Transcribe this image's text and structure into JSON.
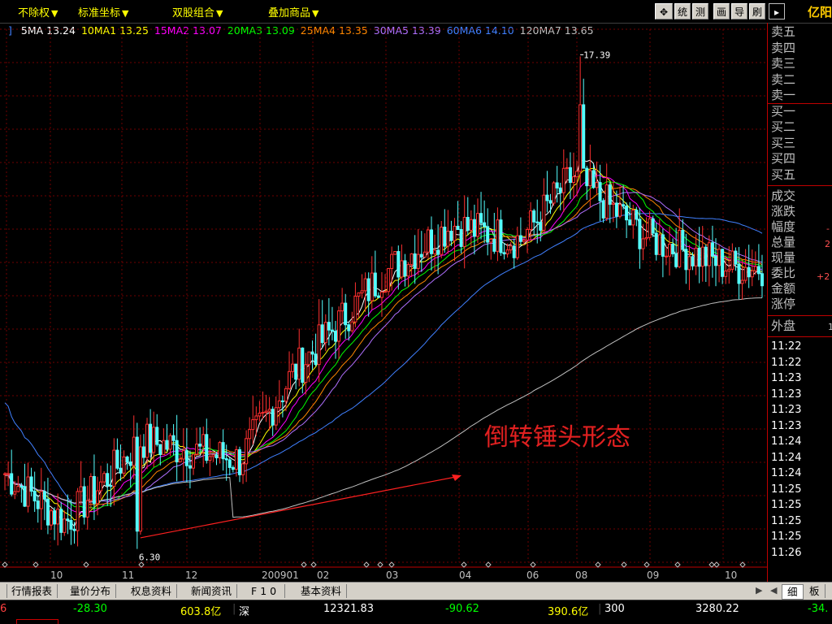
{
  "toolbar": {
    "menus": [
      "不除权",
      "标准坐标",
      "双股组合",
      "叠加商品"
    ],
    "buttons": [
      "统",
      "测",
      "画",
      "导",
      "刷"
    ],
    "stock_name": "亿阳"
  },
  "ma_legend": [
    {
      "label": "5MA 13.24",
      "color": "#ffffff"
    },
    {
      "label": "10MA1 13.25",
      "color": "#ffff00"
    },
    {
      "label": "15MA2 13.07",
      "color": "#ff00ff"
    },
    {
      "label": "20MA3 13.09",
      "color": "#00ff00"
    },
    {
      "label": "25MA4 13.35",
      "color": "#ff8800"
    },
    {
      "label": "30MA5 13.39",
      "color": "#b070ff"
    },
    {
      "label": "60MA6 14.10",
      "color": "#4080ff"
    },
    {
      "label": "120MA7 13.65",
      "color": "#c0c0c0"
    }
  ],
  "chart_data": {
    "type": "candlestick",
    "title": "倒转锤头形态",
    "y_range": [
      6.0,
      18.0
    ],
    "high_label": "17.39",
    "low_label": "6.30",
    "x_axis_labels": [
      "10",
      "11",
      "12",
      "200901",
      "02",
      "03",
      "04",
      "06",
      "08",
      "09",
      "10"
    ],
    "annotation": "倒转锤头形态",
    "series": [
      {
        "name": "MA5",
        "color": "#ffffff"
      },
      {
        "name": "MA10",
        "color": "#ffff00"
      },
      {
        "name": "MA15",
        "color": "#ff00ff"
      },
      {
        "name": "MA20",
        "color": "#00ff00"
      },
      {
        "name": "MA25",
        "color": "#ff8800"
      },
      {
        "name": "MA30",
        "color": "#b070ff"
      },
      {
        "name": "MA60",
        "color": "#4080ff"
      },
      {
        "name": "MA120",
        "color": "#c0c0c0"
      }
    ],
    "key_prices": [
      {
        "period": "2008-10",
        "low": 7.0,
        "high": 9.0
      },
      {
        "period": "2008-11",
        "low": 6.3,
        "high": 7.5
      },
      {
        "period": "2008-12",
        "low": 7.5,
        "high": 10.0
      },
      {
        "period": "2009-01",
        "low": 7.8,
        "high": 8.8
      },
      {
        "period": "2009-02",
        "low": 8.5,
        "high": 12.0
      },
      {
        "period": "2009-03",
        "low": 11.5,
        "high": 13.5
      },
      {
        "period": "2009-04",
        "low": 12.2,
        "high": 15.0
      },
      {
        "period": "2009-06",
        "low": 12.0,
        "high": 14.5
      },
      {
        "period": "2009-08",
        "low": 12.0,
        "high": 17.39
      },
      {
        "period": "2009-09",
        "low": 11.8,
        "high": 14.8
      },
      {
        "period": "2009-10",
        "low": 11.5,
        "high": 13.8
      }
    ]
  },
  "side_panel": {
    "order_book": [
      "卖五",
      "卖四",
      "卖三",
      "卖二",
      "卖一",
      "买一",
      "买二",
      "买三",
      "买四",
      "买五"
    ],
    "stats": [
      "成交",
      "涨跌",
      "幅度",
      "总量",
      "现量",
      "委比",
      "金额",
      "涨停"
    ],
    "stat_values": {
      "zf": "-",
      "zl": "2",
      "wb": "+2"
    },
    "outer": "外盘",
    "outer_value": "1",
    "times": [
      "11:22",
      "11:22",
      "11:23",
      "11:23",
      "11:23",
      "11:23",
      "11:24",
      "11:24",
      "11:24",
      "11:25",
      "11:25",
      "11:25",
      "11:25",
      "11:26"
    ]
  },
  "tabs": [
    "行情报表",
    "量价分布",
    "权息资料",
    "新闻资讯",
    "F10",
    "基本资料"
  ],
  "side_tabs": [
    "细",
    "板"
  ],
  "status": {
    "v1": "6",
    "change": "-28.30",
    "amount1": "603.8亿",
    "market": "深",
    "index_sz": "12321.83",
    "change_sz": "-90.62",
    "amount_sz": "390.6亿",
    "idx300_label": "300",
    "idx300": "3280.22",
    "change300": "-34."
  }
}
